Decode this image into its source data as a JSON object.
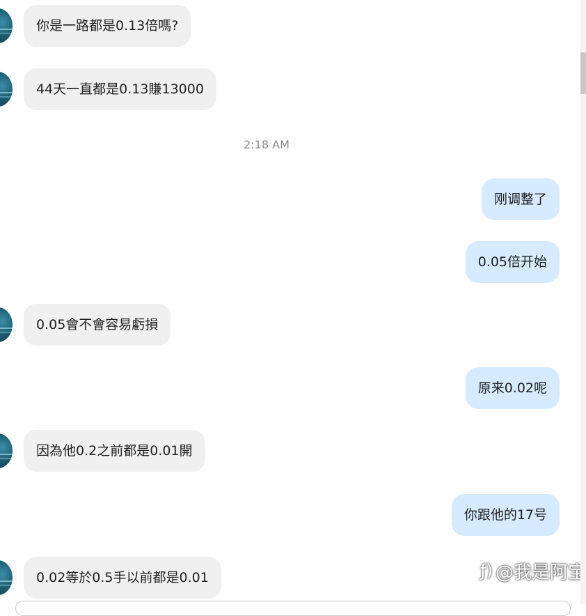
{
  "timestamp": "2:18 AM",
  "messages": [
    {
      "direction": "in",
      "text": "你是一路都是0.13倍嗎?"
    },
    {
      "direction": "in",
      "text": "44天一直都是0.13賺13000"
    },
    {
      "direction": "out",
      "text": "刚调整了"
    },
    {
      "direction": "out",
      "text": "0.05倍开始"
    },
    {
      "direction": "in",
      "text": "0.05會不會容易虧損"
    },
    {
      "direction": "out",
      "text": "原来0.02呢"
    },
    {
      "direction": "in",
      "text": "因為他0.2之前都是0.01開"
    },
    {
      "direction": "out",
      "text": "你跟他的17号"
    },
    {
      "direction": "in",
      "text": "0.02等於0.5手以前都是0.01"
    }
  ],
  "watermark": {
    "icon": "zhihu-logo-icon",
    "text": "@我是阿宝"
  },
  "colors": {
    "incoming_bubble": "#f0f0f0",
    "outgoing_bubble": "#d6ebff",
    "timestamp": "#8a8a8a"
  }
}
